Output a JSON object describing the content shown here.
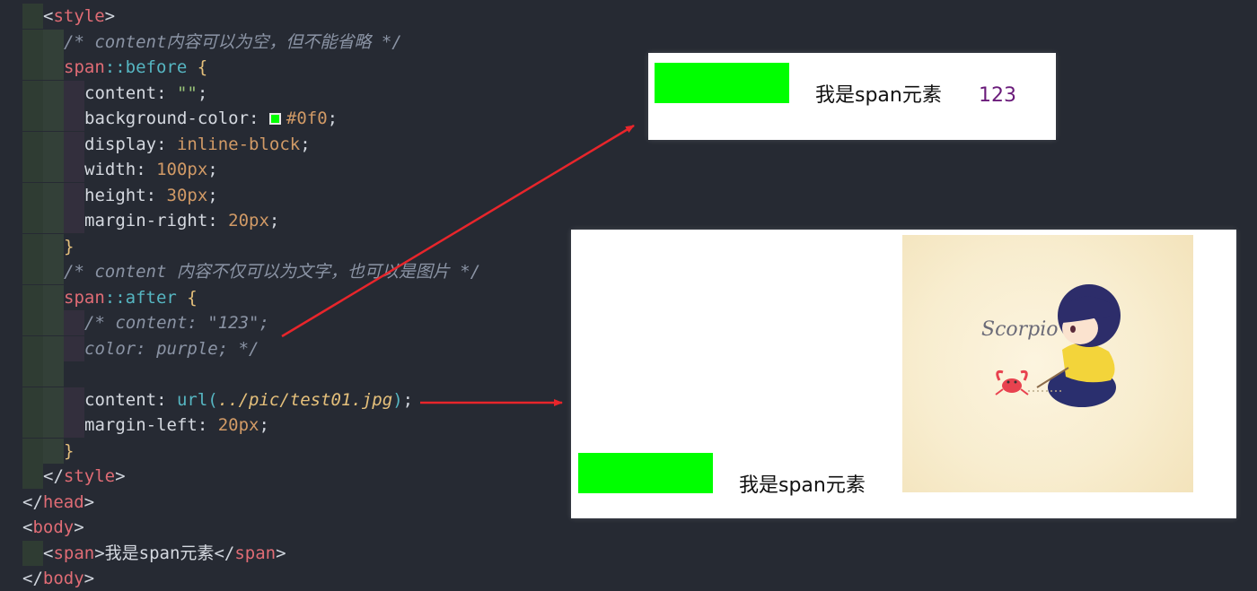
{
  "code": {
    "lines": [
      {
        "indent": 2,
        "tokens": [
          {
            "t": "<",
            "c": "t-punc"
          },
          {
            "t": "style",
            "c": "t-tag"
          },
          {
            "t": ">",
            "c": "t-punc"
          }
        ]
      },
      {
        "indent": 3,
        "tokens": [
          {
            "t": "/* content内容可以为空，但不能省略 */",
            "c": "t-comment"
          }
        ]
      },
      {
        "indent": 3,
        "tokens": [
          {
            "t": "span",
            "c": "t-sel"
          },
          {
            "t": "::before",
            "c": "t-pseudo"
          },
          {
            "t": " {",
            "c": "t-brace"
          }
        ]
      },
      {
        "indent": 4,
        "tokens": [
          {
            "t": "content: ",
            "c": "t-prop"
          },
          {
            "t": "\"\"",
            "c": "t-str"
          },
          {
            "t": ";",
            "c": "t-punc"
          }
        ]
      },
      {
        "indent": 4,
        "tokens": [
          {
            "t": "background-color: ",
            "c": "t-prop"
          },
          {
            "t": "",
            "c": "swatch"
          },
          {
            "t": "#0f0",
            "c": "t-val"
          },
          {
            "t": ";",
            "c": "t-punc"
          }
        ]
      },
      {
        "indent": 4,
        "tokens": [
          {
            "t": "display: ",
            "c": "t-prop"
          },
          {
            "t": "inline-block",
            "c": "t-val"
          },
          {
            "t": ";",
            "c": "t-punc"
          }
        ]
      },
      {
        "indent": 4,
        "tokens": [
          {
            "t": "width: ",
            "c": "t-prop"
          },
          {
            "t": "100px",
            "c": "t-num"
          },
          {
            "t": ";",
            "c": "t-punc"
          }
        ]
      },
      {
        "indent": 4,
        "tokens": [
          {
            "t": "height: ",
            "c": "t-prop"
          },
          {
            "t": "30px",
            "c": "t-num"
          },
          {
            "t": ";",
            "c": "t-punc"
          }
        ]
      },
      {
        "indent": 4,
        "tokens": [
          {
            "t": "margin-right: ",
            "c": "t-prop"
          },
          {
            "t": "20px",
            "c": "t-num"
          },
          {
            "t": ";",
            "c": "t-punc"
          }
        ]
      },
      {
        "indent": 3,
        "tokens": [
          {
            "t": "}",
            "c": "t-brace"
          }
        ]
      },
      {
        "indent": 3,
        "tokens": [
          {
            "t": "/* content 内容不仅可以为文字，也可以是图片 */",
            "c": "t-comment"
          }
        ]
      },
      {
        "indent": 3,
        "tokens": [
          {
            "t": "span",
            "c": "t-sel"
          },
          {
            "t": "::after",
            "c": "t-pseudo"
          },
          {
            "t": " {",
            "c": "t-brace"
          }
        ]
      },
      {
        "indent": 4,
        "tokens": [
          {
            "t": "/* content: \"123\";",
            "c": "t-comment"
          }
        ]
      },
      {
        "indent": 4,
        "tokens": [
          {
            "t": "color: purple; */",
            "c": "t-comment"
          }
        ]
      },
      {
        "indent": 3,
        "tokens": []
      },
      {
        "indent": 4,
        "tokens": [
          {
            "t": "content: ",
            "c": "t-prop"
          },
          {
            "t": "url(",
            "c": "t-url"
          },
          {
            "t": "../pic/test01.jpg",
            "c": "t-path"
          },
          {
            "t": ")",
            "c": "t-url"
          },
          {
            "t": ";",
            "c": "t-punc"
          }
        ]
      },
      {
        "indent": 4,
        "tokens": [
          {
            "t": "margin-left: ",
            "c": "t-prop"
          },
          {
            "t": "20px",
            "c": "t-num"
          },
          {
            "t": ";",
            "c": "t-punc"
          }
        ]
      },
      {
        "indent": 3,
        "tokens": [
          {
            "t": "}",
            "c": "t-brace"
          }
        ]
      },
      {
        "indent": 2,
        "tokens": [
          {
            "t": "</",
            "c": "t-punc"
          },
          {
            "t": "style",
            "c": "t-tag"
          },
          {
            "t": ">",
            "c": "t-punc"
          }
        ]
      },
      {
        "indent": 1,
        "tokens": [
          {
            "t": "</",
            "c": "t-punc"
          },
          {
            "t": "head",
            "c": "t-tag"
          },
          {
            "t": ">",
            "c": "t-punc"
          }
        ]
      },
      {
        "indent": 1,
        "tokens": [
          {
            "t": "<",
            "c": "t-punc"
          },
          {
            "t": "body",
            "c": "t-tag"
          },
          {
            "t": ">",
            "c": "t-punc"
          }
        ]
      },
      {
        "indent": 2,
        "tokens": [
          {
            "t": "<",
            "c": "t-punc"
          },
          {
            "t": "span",
            "c": "t-tag"
          },
          {
            "t": ">",
            "c": "t-punc"
          },
          {
            "t": "我是span元素",
            "c": "t-text"
          },
          {
            "t": "</",
            "c": "t-punc"
          },
          {
            "t": "span",
            "c": "t-tag"
          },
          {
            "t": ">",
            "c": "t-punc"
          }
        ]
      },
      {
        "indent": 1,
        "tokens": [
          {
            "t": "</",
            "c": "t-punc"
          },
          {
            "t": "body",
            "c": "t-tag"
          },
          {
            "t": ">",
            "c": "t-punc"
          }
        ]
      }
    ]
  },
  "preview_top": {
    "span_text": "我是span元素",
    "after_text": "123",
    "after_color": "#6a1b7a",
    "before_color": "#00ff00"
  },
  "preview_bottom": {
    "span_text": "我是span元素",
    "image_icon": "scorpio-anime-image",
    "image_caption": "Scorpio",
    "before_color": "#00ff00"
  },
  "colors": {
    "background": "#262a33",
    "arrow": "#e8252b"
  }
}
